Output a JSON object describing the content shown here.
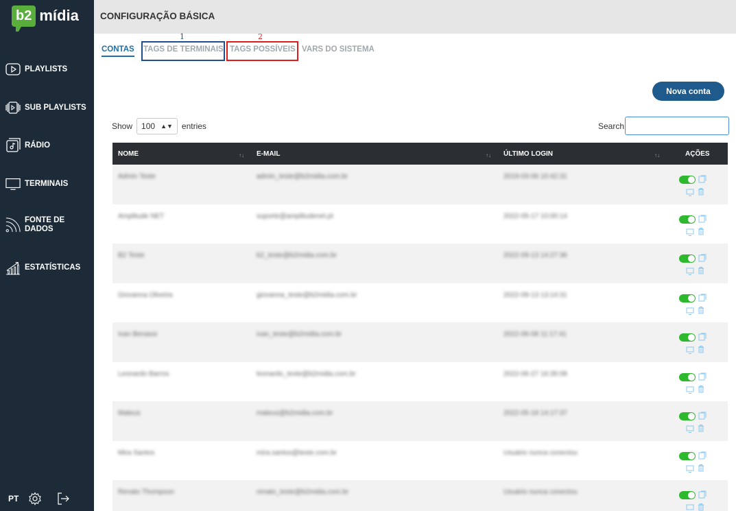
{
  "sidebar": {
    "logo_badge": "b2",
    "logo_text": "mídia",
    "items": [
      {
        "label": "PLAYLISTS",
        "icon": "play-icon"
      },
      {
        "label": "SUB PLAYLISTS",
        "icon": "sub-playlists-icon"
      },
      {
        "label": "RÁDIO",
        "icon": "radio-icon"
      },
      {
        "label": "TERMINAIS",
        "icon": "monitor-icon"
      },
      {
        "label_line1": "FONTE DE",
        "label_line2": "DADOS",
        "icon": "rss-icon"
      },
      {
        "label": "ESTATÍSTICAS",
        "icon": "stats-icon"
      }
    ],
    "footer": {
      "language": "PT",
      "settings_icon": "gear-icon",
      "logout_icon": "logout-icon"
    }
  },
  "header": {
    "title": "CONFIGURAÇÃO BÁSICA"
  },
  "tabs": [
    {
      "label": "CONTAS",
      "active": true
    },
    {
      "label": "TAGS DE TERMINAIS",
      "active": false,
      "marker": "1",
      "marker_color": "#1f4e8c"
    },
    {
      "label": "TAGS POSSÍVEIS",
      "active": false,
      "marker": "2",
      "marker_color": "#e01b1b"
    },
    {
      "label": "VARS DO SISTEMA",
      "active": false
    }
  ],
  "new_account_button": "Nova conta",
  "length": {
    "show_label": "Show",
    "value": "100",
    "entries_label": "entries"
  },
  "search": {
    "label": "Search:",
    "value": ""
  },
  "table": {
    "columns": [
      "NOME",
      "E-MAIL",
      "ÚLTIMO LOGIN",
      "AÇÕES"
    ],
    "rows": [
      {
        "nome": "Admin Teste",
        "email": "admin_teste@b2midia.com.br",
        "login": "2019-03-06 10:42:31"
      },
      {
        "nome": "Amplitude NET",
        "email": "suporte@amplitudenet.pt",
        "login": "2022-05-17 10:00:14"
      },
      {
        "nome": "B2 Teste",
        "email": "b2_teste@b2midia.com.br",
        "login": "2022-09-13 14:27:36"
      },
      {
        "nome": "Giovanna Oliveira",
        "email": "giovanna_teste@b2midia.com.br",
        "login": "2022-09-13 13:14:31"
      },
      {
        "nome": "Ivan Benassi",
        "email": "ivan_teste@b2midia.com.br",
        "login": "2022-06-08 11:17:41"
      },
      {
        "nome": "Leonardo Barros",
        "email": "leonardo_teste@b2midia.com.br",
        "login": "2022-06-27 16:35:08"
      },
      {
        "nome": "Mateus",
        "email": "mateus@b2midia.com.br",
        "login": "2022-05-18 14:17:37"
      },
      {
        "nome": "Mira Santos",
        "email": "mira.santos@teste.com.br",
        "login": "Usuário nunca conectou"
      },
      {
        "nome": "Renato Thompson",
        "email": "renato_teste@b2midia.com.br",
        "login": "Usuário nunca conectou"
      }
    ]
  },
  "colors": {
    "sidebar": "#1d2b39",
    "accent": "#1f6ea8",
    "button": "#1f5a8c",
    "toggle_on": "#2eb82e",
    "header_row": "#2b2f33"
  }
}
